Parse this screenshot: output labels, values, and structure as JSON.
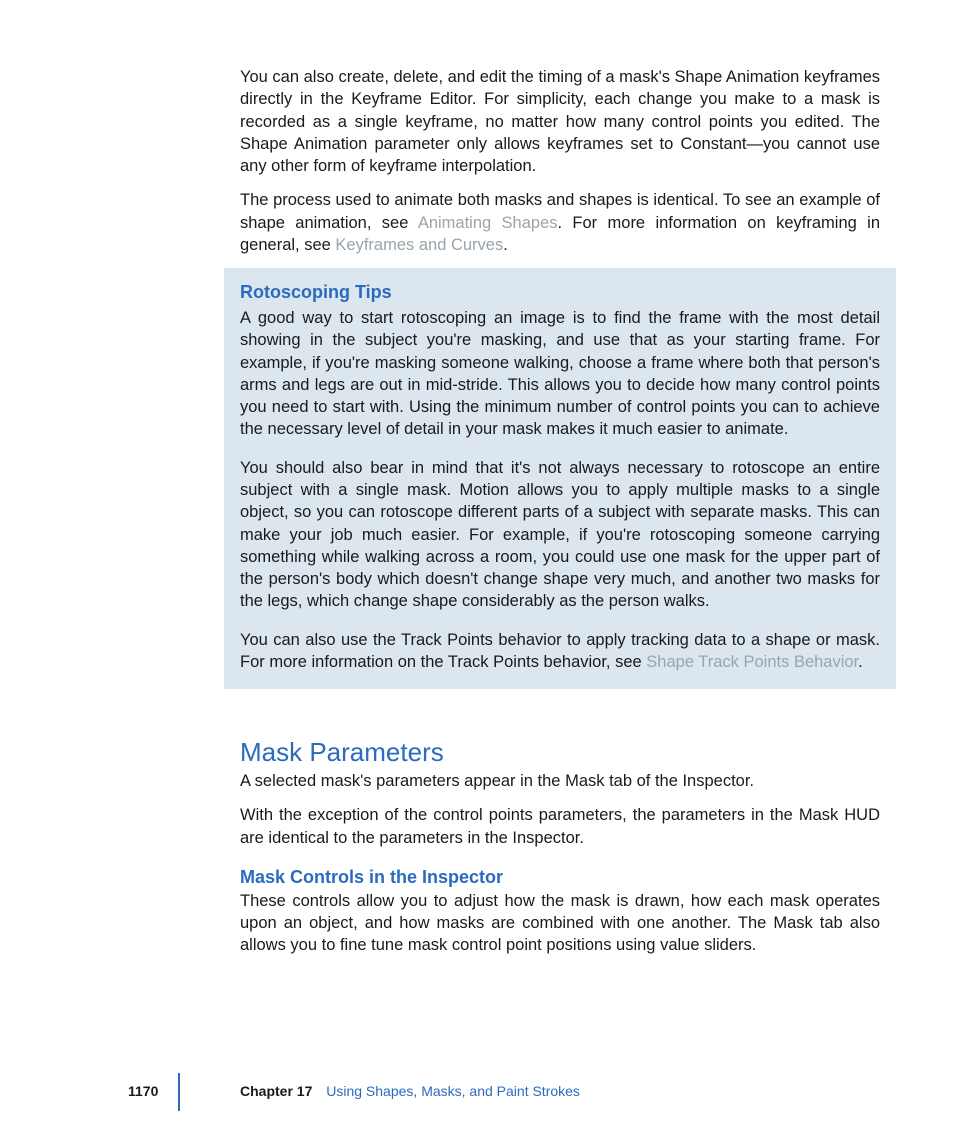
{
  "body": {
    "p1": "You can also create, delete, and edit the timing of a mask's Shape Animation keyframes directly in the Keyframe Editor. For simplicity, each change you make to a mask is recorded as a single keyframe, no matter how many control points you edited. The Shape Animation parameter only allows keyframes set to Constant—you cannot use any other form of keyframe interpolation.",
    "p2a": "The process used to animate both masks and shapes is identical. To see an example of shape animation, see ",
    "p2_link1": "Animating Shapes",
    "p2b": ". For more information on keyframing in general, see ",
    "p2_link2": "Keyframes and Curves",
    "p2c": "."
  },
  "tipbox": {
    "title": "Rotoscoping Tips",
    "p1": "A good way to start rotoscoping an image is to find the frame with the most detail showing in the subject you're masking, and use that as your starting frame. For example, if you're masking someone walking, choose a frame where both that person's arms and legs are out in mid-stride. This allows you to decide how many control points you need to start with. Using the minimum number of control points you can to achieve the necessary level of detail in your mask makes it much easier to animate.",
    "p2": "You should also bear in mind that it's not always necessary to rotoscope an entire subject with a single mask. Motion allows you to apply multiple masks to a single object, so you can rotoscope different parts of a subject with separate masks. This can make your job much easier. For example, if you're rotoscoping someone carrying something while walking across a room, you could use one mask for the upper part of the person's body which doesn't change shape very much, and another two masks for the legs, which change shape considerably as the person walks.",
    "p3a": "You can also use the Track Points behavior to apply tracking data to a shape or mask. For more information on the Track Points behavior, see ",
    "p3_link": "Shape Track Points Behavior",
    "p3b": "."
  },
  "section": {
    "title": "Mask Parameters",
    "p1": "A selected mask's parameters appear in the Mask tab of the Inspector.",
    "p2": "With the exception of the control points parameters, the parameters in the Mask HUD are identical to the parameters in the Inspector.",
    "sub_title": "Mask Controls in the Inspector",
    "p3": "These controls allow you to adjust how the mask is drawn, how each mask operates upon an object, and how masks are combined with one another. The Mask tab also allows you to fine tune mask control point positions using value sliders."
  },
  "footer": {
    "page": "1170",
    "chapter_label": "Chapter 17",
    "chapter_title": "Using Shapes, Masks, and Paint Strokes"
  }
}
